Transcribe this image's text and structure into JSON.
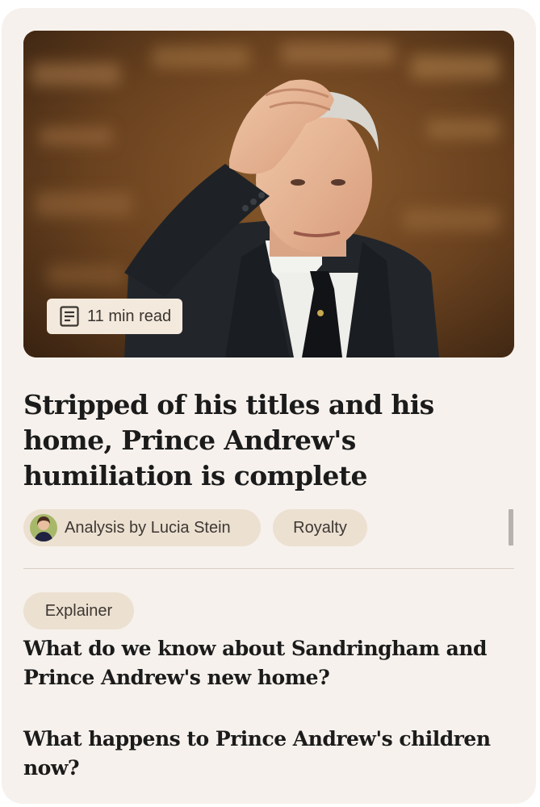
{
  "article": {
    "read_time": "11 min read",
    "headline": "Stripped of his titles and his home, Prince Andrew's humiliation is complete",
    "author_chip": "Analysis by Lucia Stein",
    "topic_chip": "Royalty"
  },
  "related": {
    "badge": "Explainer",
    "links": [
      "What do we know about Sandringham and Prince Andrew's new home?",
      "What happens to Prince Andrew's children now?"
    ]
  },
  "colors": {
    "card_background": "#f6f1ec",
    "chip_background": "#ece0d1",
    "text": "#1b1b1b"
  },
  "icons": {
    "read_time": "document-icon"
  }
}
